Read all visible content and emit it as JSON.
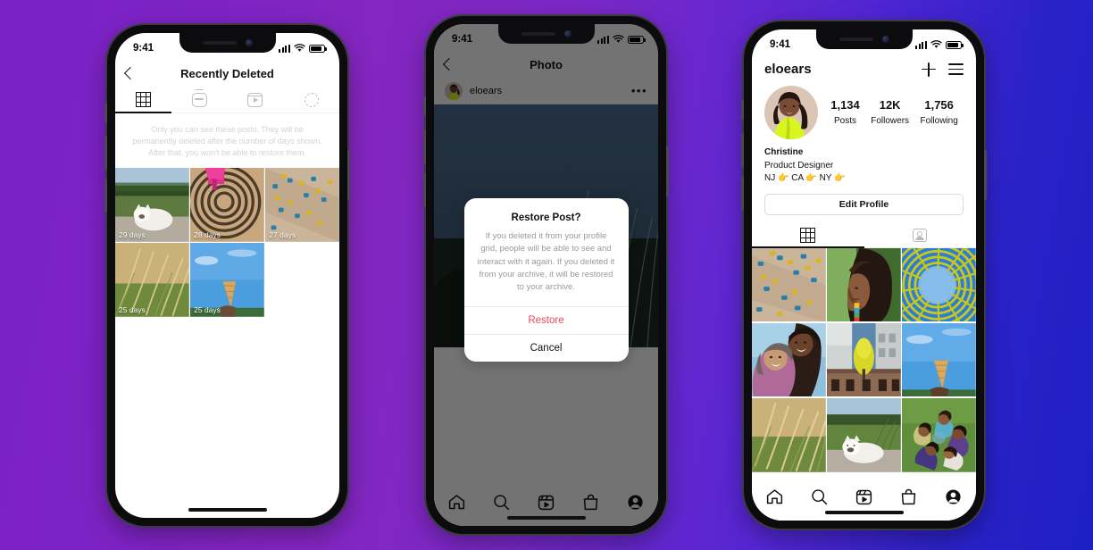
{
  "background": {
    "from": "#7a22c6",
    "to": "#1d1fc4"
  },
  "status_bar": {
    "time": "9:41"
  },
  "phone1": {
    "nav": {
      "back_icon": "chevron-left-icon",
      "title": "Recently Deleted"
    },
    "tabs": [
      {
        "icon": "grid-icon",
        "active": true
      },
      {
        "icon": "igtv-icon",
        "active": false
      },
      {
        "icon": "reels-icon",
        "active": false
      },
      {
        "icon": "dashed-circle-icon",
        "active": false
      }
    ],
    "hint": "Only you can see these posts. They will be permanently deleted after the number of days shown. After that, you won't be able to restore them.",
    "grid": [
      {
        "label": "29 days",
        "alt": "white terrier dog lying on pavement with grass"
      },
      {
        "label": "28 days",
        "alt": "pink sculpture shadow spiral pattern on concrete"
      },
      {
        "label": "27 days",
        "alt": "blue and yellow climbing holds on a bouldering wall"
      },
      {
        "label": "25 days",
        "alt": "golden wheat grass close up"
      },
      {
        "label": "25 days",
        "alt": "hand holding waffle ice cream cone against blue sky"
      }
    ]
  },
  "phone2": {
    "nav": {
      "back_icon": "chevron-left-icon",
      "title": "Photo"
    },
    "post": {
      "username": "eloears",
      "menu_icon": "more-options-icon",
      "alt": "dusk landscape with tall grasses"
    },
    "dialog": {
      "title": "Restore Post?",
      "text": "If you deleted it from your profile grid, people will be able to see and interact with it again. If you deleted it from your archive, it will be restored to your archive.",
      "confirm_label": "Restore",
      "cancel_label": "Cancel",
      "confirm_color": "#ed4956"
    },
    "bottom_nav": [
      {
        "icon": "home-icon"
      },
      {
        "icon": "search-icon"
      },
      {
        "icon": "reels-icon"
      },
      {
        "icon": "shop-icon"
      },
      {
        "icon": "profile-icon"
      }
    ]
  },
  "phone3": {
    "header": {
      "username": "eloears",
      "add_icon": "plus-icon",
      "menu_icon": "hamburger-icon"
    },
    "stats": [
      {
        "value": "1,134",
        "label": "Posts"
      },
      {
        "value": "12K",
        "label": "Followers"
      },
      {
        "value": "1,756",
        "label": "Following"
      }
    ],
    "bio": {
      "name": "Christine",
      "role": "Product Designer",
      "locations": "NJ 👉 CA 👉 NY 👉"
    },
    "edit_profile_label": "Edit Profile",
    "tabs": [
      {
        "icon": "grid-icon",
        "active": true
      },
      {
        "icon": "tagged-icon",
        "active": false
      }
    ],
    "grid": [
      {
        "alt": "blue and yellow climbing holds on bouldering wall"
      },
      {
        "alt": "profile of woman with curly hair and colorful earring"
      },
      {
        "alt": "yellow spiral sculpture against blue sky"
      },
      {
        "alt": "two friends smiling outdoors"
      },
      {
        "alt": "yellow tree between white buildings"
      },
      {
        "alt": "hand holding waffle cone against blue sky"
      },
      {
        "alt": "golden wheat grass close up"
      },
      {
        "alt": "white terrier dog lying on pavement"
      },
      {
        "alt": "group of friends lying in circle on grass"
      }
    ],
    "bottom_nav": [
      {
        "icon": "home-icon"
      },
      {
        "icon": "search-icon"
      },
      {
        "icon": "reels-icon"
      },
      {
        "icon": "shop-icon"
      },
      {
        "icon": "profile-icon"
      }
    ]
  }
}
